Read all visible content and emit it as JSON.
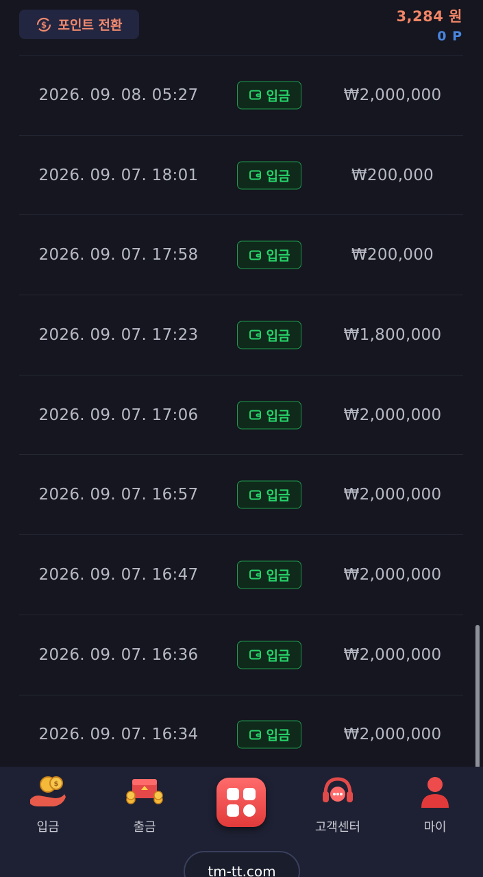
{
  "header": {
    "point_button_label": "포인트 전환",
    "balance_won": "3,284 원",
    "balance_points": "0 P"
  },
  "transactions": [
    {
      "date": "2026. 09. 08. 05:27",
      "type": "입금",
      "amount": "₩2,000,000"
    },
    {
      "date": "2026. 09. 07. 18:01",
      "type": "입금",
      "amount": "₩200,000"
    },
    {
      "date": "2026. 09. 07. 17:58",
      "type": "입금",
      "amount": "₩200,000"
    },
    {
      "date": "2026. 09. 07. 17:23",
      "type": "입금",
      "amount": "₩1,800,000"
    },
    {
      "date": "2026. 09. 07. 17:06",
      "type": "입금",
      "amount": "₩2,000,000"
    },
    {
      "date": "2026. 09. 07. 16:57",
      "type": "입금",
      "amount": "₩2,000,000"
    },
    {
      "date": "2026. 09. 07. 16:47",
      "type": "입금",
      "amount": "₩2,000,000"
    },
    {
      "date": "2026. 09. 07. 16:36",
      "type": "입금",
      "amount": "₩2,000,000"
    },
    {
      "date": "2026. 09. 07. 16:34",
      "type": "입금",
      "amount": "₩2,000,000"
    }
  ],
  "bottom_nav": {
    "items": [
      {
        "label": "입금",
        "icon": "deposit-coins-icon"
      },
      {
        "label": "출금",
        "icon": "withdraw-chest-icon"
      },
      {
        "label": "",
        "icon": "menu-grid-icon"
      },
      {
        "label": "고객센터",
        "icon": "headset-icon"
      },
      {
        "label": "마이",
        "icon": "user-icon"
      }
    ]
  },
  "domain": "tm-tt.com",
  "colors": {
    "background": "#15161f",
    "accent_orange": "#f08566",
    "points_blue": "#4a86e0",
    "deposit_green": "#27d46a",
    "nav_background": "#1e2133",
    "center_button_red": "#e23a3a"
  }
}
